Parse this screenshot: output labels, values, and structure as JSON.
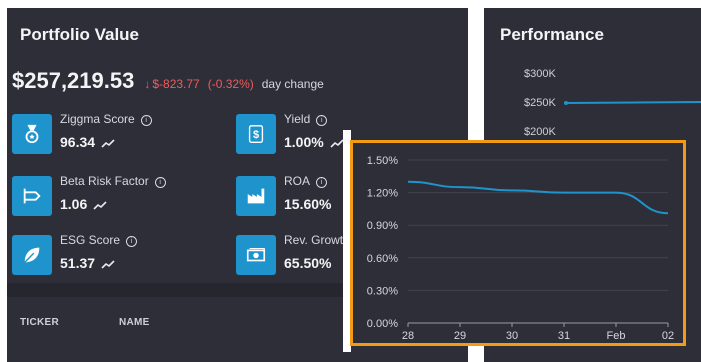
{
  "portfolio": {
    "title": "Portfolio Value",
    "value": "$257,219.53",
    "change_arrow": "↓",
    "change": "$-823.77",
    "change_pct": "(-0.32%)",
    "change_label": "day change",
    "metrics": [
      {
        "name": "Ziggma Score",
        "value": "96.34",
        "icon": "medal-icon"
      },
      {
        "name": "Beta Risk Factor",
        "value": "1.06",
        "icon": "beta-icon"
      },
      {
        "name": "ESG Score",
        "value": "51.37",
        "icon": "leaf-icon"
      },
      {
        "name": "Yield",
        "value": "1.00%",
        "icon": "dollar-icon"
      },
      {
        "name": "ROA",
        "value": "15.60%",
        "icon": "factory-icon"
      },
      {
        "name": "Rev. Growt",
        "value": "65.50%",
        "icon": "cash-icon"
      }
    ],
    "table_headers": {
      "ticker": "TICKER",
      "name": "NAME"
    }
  },
  "performance": {
    "title": "Performance",
    "ticks": [
      "$300K",
      "$250K",
      "$200K"
    ]
  },
  "colors": {
    "accent": "#1f93cb",
    "negative": "#f05b5b",
    "highlight_border": "#f39b13",
    "panel": "#2e2e38"
  },
  "chart_data": {
    "type": "line",
    "title": "",
    "xlabel": "",
    "ylabel": "",
    "x": [
      "28",
      "29",
      "30",
      "31",
      "Feb",
      "02"
    ],
    "series": [
      {
        "values": [
          1.3,
          1.25,
          1.22,
          1.2,
          1.2,
          1.01
        ]
      }
    ],
    "yticks": [
      "0.00%",
      "0.30%",
      "0.60%",
      "0.90%",
      "1.20%",
      "1.50%"
    ],
    "ylim": [
      0,
      1.5
    ],
    "grid": true,
    "line_color": "#1f93cb"
  }
}
